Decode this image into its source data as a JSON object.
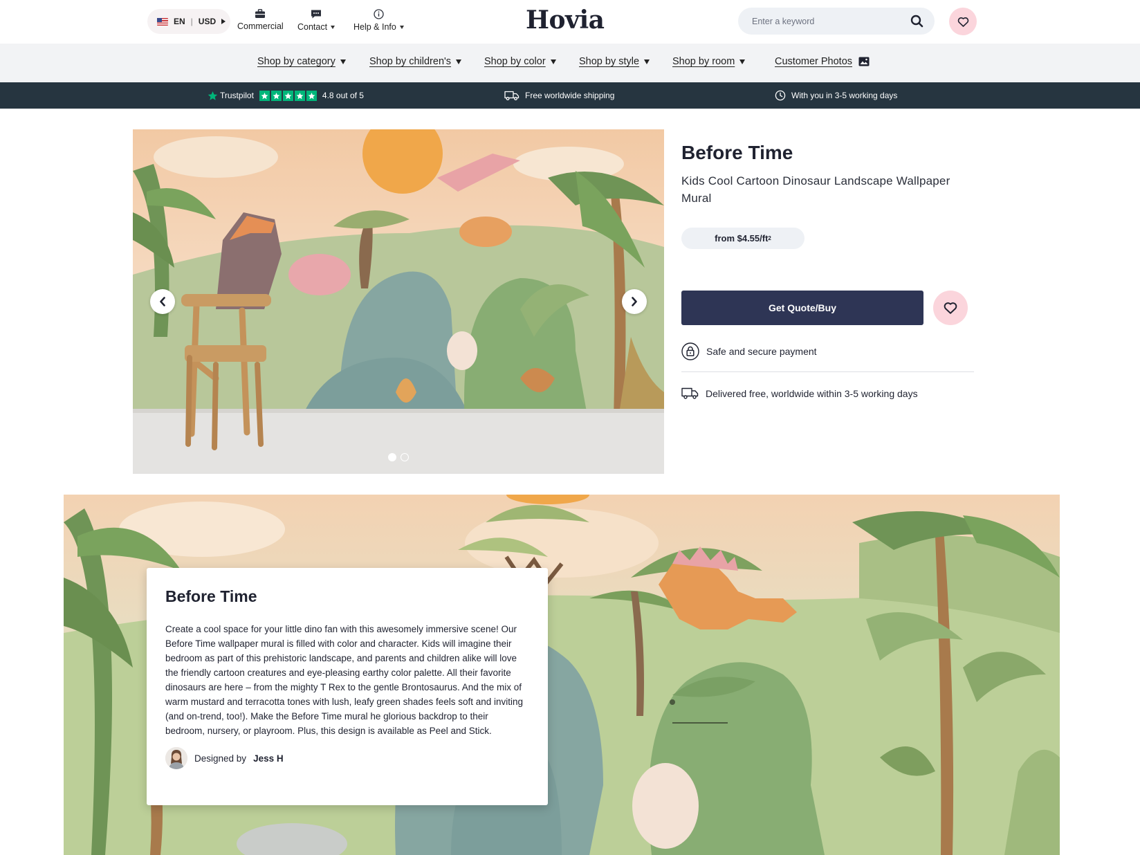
{
  "header": {
    "language": "EN",
    "currency": "USD",
    "util_links": [
      {
        "label": "Commercial",
        "icon": "briefcase-icon"
      },
      {
        "label": "Contact",
        "icon": "chat-icon"
      },
      {
        "label": "Help & Info",
        "icon": "info-icon"
      }
    ],
    "logo": "Hovia",
    "search_placeholder": "Enter a keyword"
  },
  "nav": {
    "items": [
      {
        "label": "Shop by category"
      },
      {
        "label": "Shop by children's"
      },
      {
        "label": "Shop by color"
      },
      {
        "label": "Shop by style"
      },
      {
        "label": "Shop by room"
      },
      {
        "label": "Customer Photos"
      }
    ]
  },
  "trustbar": {
    "trustpilot": "Trustpilot",
    "rating_text": "4.8 out of 5",
    "rating_stars": 5,
    "shipping": "Free worldwide shipping",
    "delivery": "With you in 3-5 working days"
  },
  "gallery": {
    "slides_total": 2,
    "active_slide": 1
  },
  "product": {
    "title": "Before Time",
    "subtitle": "Kids Cool Cartoon Dinosaur Landscape Wallpaper Mural",
    "price_prefix": "from $4.55/ft",
    "price_unit_sup": "2",
    "buy_label": "Get Quote/Buy",
    "feature_payment": "Safe and secure payment",
    "feature_delivery": "Delivered free, worldwide within 3-5 working days"
  },
  "story": {
    "title": "Before Time",
    "body": "Create a cool space for your little dino fan with this awesomely immersive scene! Our Before Time wallpaper mural is filled with color and character. Kids will imagine their bedroom as part of this prehistoric landscape, and parents and children alike will love the friendly cartoon creatures and eye-pleasing earthy color palette. All their favorite dinosaurs are here – from the mighty T Rex to the gentle Brontosaurus. And the mix of warm mustard and terracotta tones with lush, leafy green shades feels soft and inviting (and on-trend, too!). Make the Before Time mural he glorious backdrop to their bedroom, nursery, or playroom. Plus, this design is available as Peel and Stick.",
    "designed_by_label": "Designed by",
    "designer": "Jess H"
  },
  "colors": {
    "primary_button": "#2e3555",
    "trustbar": "#263540",
    "heart_bg": "#fbd5dc",
    "trustpilot_green": "#00b67a"
  }
}
